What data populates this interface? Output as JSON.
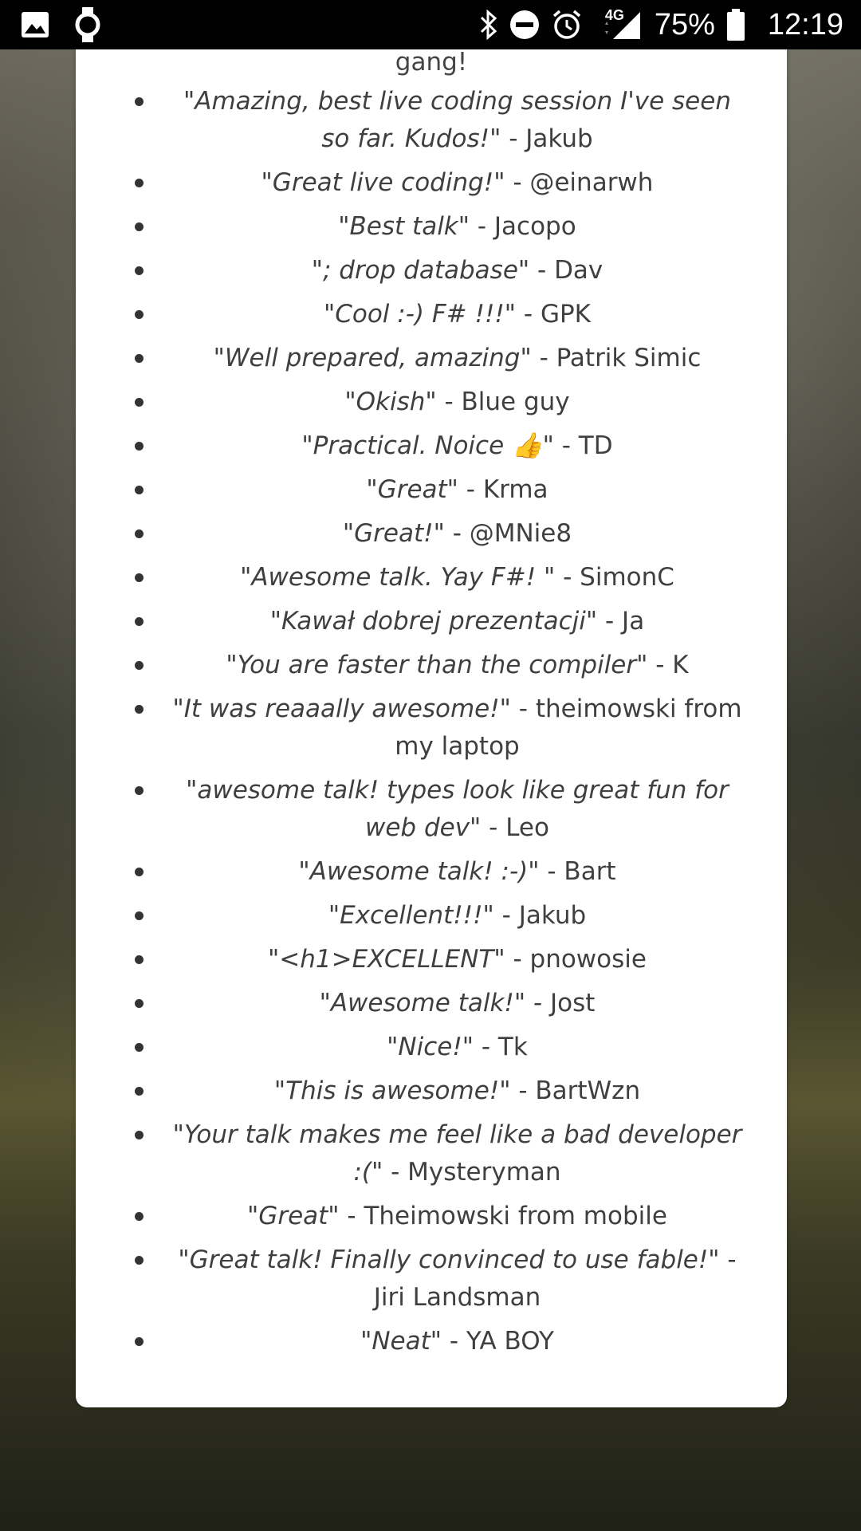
{
  "status_bar": {
    "battery": "75%",
    "time": "12:19",
    "network": "4G",
    "icons": [
      "gallery-icon",
      "watch-icon",
      "bluetooth-icon",
      "do-not-disturb-icon",
      "alarm-icon",
      "signal-icon",
      "battery-icon"
    ]
  },
  "card": {
    "top_text": "gang!",
    "comments": [
      {
        "quote": "\"Amazing, best live coding session I've seen so far. Kudos!\"",
        "author": " - Jakub"
      },
      {
        "quote": "\"Great live coding!\"",
        "author": " - @einarwh"
      },
      {
        "quote": "\"Best talk\"",
        "author": " - Jacopo"
      },
      {
        "quote": "\"; drop database\"",
        "author": " - Dav"
      },
      {
        "quote": "\"Cool :-) F# !!!\"",
        "author": " - GPK"
      },
      {
        "quote": "\"Well prepared, amazing\"",
        "author": " - Patrik Simic"
      },
      {
        "quote": "\"Okish\"",
        "author": " - Blue guy"
      },
      {
        "quote": "\"Practical. Noice 👍\"",
        "author": " - TD"
      },
      {
        "quote": "\"Great\"",
        "author": " - Krma"
      },
      {
        "quote": "\"Great!\"",
        "author": " - @MNie8"
      },
      {
        "quote": "\"Awesome talk. Yay F#! \"",
        "author": " - SimonC"
      },
      {
        "quote": "\"Kawał dobrej prezentacji\"",
        "author": " - Ja"
      },
      {
        "quote": "\"You are faster than the compiler\"",
        "author": " - K"
      },
      {
        "quote": "\"It was reaaally awesome!\"",
        "author": " - theimowski from my laptop"
      },
      {
        "quote": "\"awesome talk! types look like great fun for web dev\"",
        "author": " - Leo"
      },
      {
        "quote": "\"Awesome talk! :-)\"",
        "author": " - Bart"
      },
      {
        "quote": "\"Excellent!!!\"",
        "author": " - Jakub"
      },
      {
        "quote": "\"<h1>EXCELLENT\"",
        "author": " - pnowosie"
      },
      {
        "quote": "\"Awesome talk!\"",
        "author": " - Jost"
      },
      {
        "quote": "\"Nice!\"",
        "author": " - Tk"
      },
      {
        "quote": "\"This is awesome!\"",
        "author": " - BartWzn"
      },
      {
        "quote": "\"Your talk makes me feel like a bad developer :(\"",
        "author": " - Mysteryman"
      },
      {
        "quote": "\"Great\"",
        "author": " - Theimowski from mobile"
      },
      {
        "quote": "\"Great talk! Finally convinced to use fable!\"",
        "author": " - Jiri Landsman"
      },
      {
        "quote": "\"Neat\"",
        "author": " - YA BOY"
      }
    ]
  }
}
